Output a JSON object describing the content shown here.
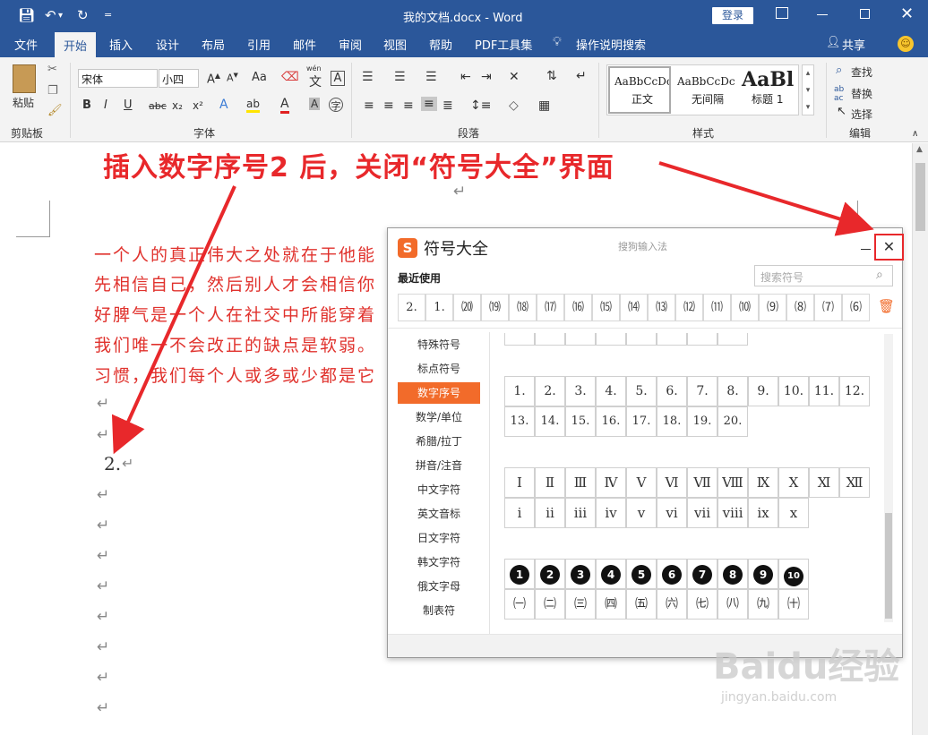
{
  "title_bar": {
    "title": "我的文档.docx  -  Word",
    "login_label": "登录",
    "qat_more": "="
  },
  "tabs": [
    "文件",
    "开始",
    "插入",
    "设计",
    "布局",
    "引用",
    "邮件",
    "审阅",
    "视图",
    "帮助",
    "PDF工具集",
    "操作说明搜索"
  ],
  "share_label": "共享",
  "ribbon": {
    "clipboard": {
      "paste_label": "粘贴",
      "group_label": "剪贴板"
    },
    "font": {
      "font_name": "宋体",
      "font_size": "小四",
      "group_label": "字体",
      "aa_label": "Aa",
      "phonetic": "wén",
      "A_label": "A",
      "bold": "B",
      "italic": "I",
      "underline": "U",
      "strike": "abc",
      "sub": "x₂",
      "sup": "x²"
    },
    "paragraph": {
      "group_label": "段落"
    },
    "styles": {
      "group_label": "样式",
      "items": [
        {
          "preview": "AaBbCcDc",
          "label": "正文"
        },
        {
          "preview": "AaBbCcDc",
          "label": "无间隔"
        },
        {
          "preview": "AaBl",
          "label": "标题 1"
        }
      ]
    },
    "editing": {
      "group_label": "编辑",
      "find": "查找",
      "replace": "替换",
      "select": "选择"
    }
  },
  "annotation": {
    "text": "插入数字序号2 后，关闭“符号大全”界面",
    "color": "#e8282b"
  },
  "document": {
    "lines": [
      "一个人的真正伟大之处就在于他能",
      "先相信自己，然后别人才会相信你",
      "好脾气是一个人在社交中所能穿着",
      "我们唯一不会改正的缺点是软弱。",
      "习惯，我们每个人或多或少都是它"
    ],
    "inserted": "2.",
    "text_color": "#e0322d"
  },
  "dialog": {
    "title": "符号大全",
    "subtitle": "搜狗输入法",
    "recent_label": "最近使用",
    "search_placeholder": "搜索符号",
    "recent": [
      "2.",
      "1.",
      "⒇",
      "⒆",
      "⒅",
      "⒄",
      "⒃",
      "⒂",
      "⒁",
      "⒀",
      "⑿",
      "⑾",
      "⑽",
      "⑼",
      "⑻",
      "⑺",
      "⑹"
    ],
    "categories": [
      "特殊符号",
      "标点符号",
      "数字序号",
      "数学/单位",
      "希腊/拉丁",
      "拼音/注音",
      "中文字符",
      "英文音标",
      "日文字符",
      "韩文字符",
      "俄文字母",
      "制表符"
    ],
    "active_category": "数字序号",
    "numbers_row1": [
      "1.",
      "2.",
      "3.",
      "4.",
      "5.",
      "6.",
      "7.",
      "8.",
      "9.",
      "10.",
      "11.",
      "12."
    ],
    "numbers_row2": [
      "13.",
      "14.",
      "15.",
      "16.",
      "17.",
      "18.",
      "19.",
      "20."
    ],
    "roman_upper": [
      "Ⅰ",
      "Ⅱ",
      "Ⅲ",
      "Ⅳ",
      "Ⅴ",
      "Ⅵ",
      "Ⅶ",
      "Ⅷ",
      "Ⅸ",
      "Ⅹ",
      "Ⅺ",
      "Ⅻ"
    ],
    "roman_lower": [
      "ⅰ",
      "ⅱ",
      "ⅲ",
      "ⅳ",
      "ⅴ",
      "ⅵ",
      "ⅶ",
      "ⅷ",
      "ⅸ",
      "ⅹ"
    ],
    "circled": [
      "1",
      "2",
      "3",
      "4",
      "5",
      "6",
      "7",
      "8",
      "9",
      "10"
    ],
    "paren_cn": [
      "㈠",
      "㈡",
      "㈢",
      "㈣",
      "㈤",
      "㈥",
      "㈦",
      "㈧",
      "㈨",
      "㈩"
    ],
    "accent": "#f26b2a"
  },
  "watermark": {
    "brand": "Baidu经验",
    "url": "jingyan.baidu.com"
  }
}
